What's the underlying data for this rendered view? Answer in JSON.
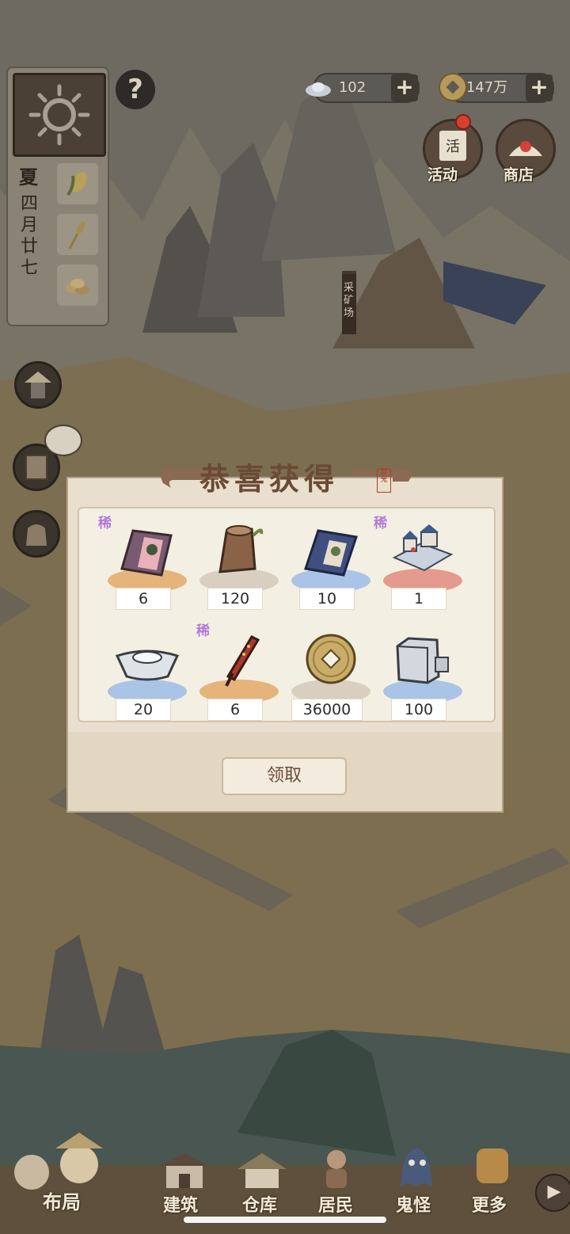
{
  "resources": {
    "silver": "102",
    "coins": "147万"
  },
  "calendar": {
    "season": "夏",
    "date": [
      "四",
      "月",
      "廿",
      "七"
    ]
  },
  "buttons": {
    "help": "?",
    "activity": "活动",
    "shop": "商店"
  },
  "map": {
    "mine_sign": "采矿场"
  },
  "dialog": {
    "title": "恭喜获得",
    "seal": "百鬼",
    "rare_tag": "稀",
    "claim": "领取",
    "items": [
      {
        "icon": "portrait-book-icon",
        "count": "6",
        "rare": true,
        "plate": "#e4b47a"
      },
      {
        "icon": "wood-log-icon",
        "count": "120",
        "rare": false,
        "plate": "#d9cfc0"
      },
      {
        "icon": "blue-book-icon",
        "count": "10",
        "rare": false,
        "plate": "#a9c4e6"
      },
      {
        "icon": "building-model-icon",
        "count": "1",
        "rare": true,
        "plate": "#e49a8c"
      },
      {
        "icon": "silver-ingot-icon",
        "count": "20",
        "rare": false,
        "plate": "#a9c4e6"
      },
      {
        "icon": "firecracker-icon",
        "count": "6",
        "rare": true,
        "plate": "#e4b47a"
      },
      {
        "icon": "copper-coin-icon",
        "count": "36000",
        "rare": false,
        "plate": "#d9cfc0"
      },
      {
        "icon": "stone-block-icon",
        "count": "100",
        "rare": false,
        "plate": "#a9c4e6"
      }
    ]
  },
  "nav": {
    "layout": "布局",
    "build": "建筑",
    "warehouse": "仓库",
    "residents": "居民",
    "ghosts": "鬼怪",
    "more": "更多"
  }
}
